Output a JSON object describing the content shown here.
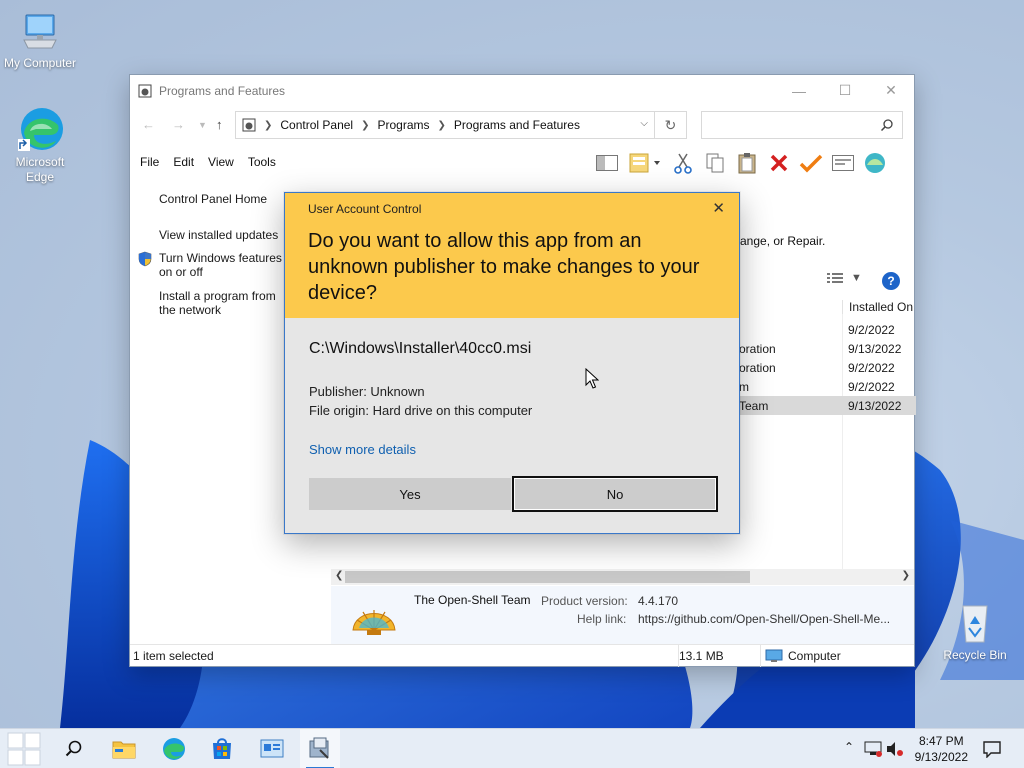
{
  "desktop": {
    "icons": [
      {
        "label": "My Computer"
      },
      {
        "label": "Microsoft Edge"
      },
      {
        "label": "Recycle Bin"
      }
    ]
  },
  "window": {
    "title": "Programs and Features",
    "breadcrumb": [
      "Control Panel",
      "Programs",
      "Programs and Features"
    ],
    "search_placeholder": "",
    "menu": [
      "File",
      "Edit",
      "View",
      "Tools"
    ],
    "left_links": {
      "home": "Control Panel Home",
      "updates": "View installed updates",
      "features": "Turn Windows features on or off",
      "install": "Install a program from the network"
    },
    "hint_text": "ange, or Repair.",
    "column_header": "Installed On",
    "rows": [
      {
        "publisher": "",
        "date": "9/2/2022",
        "selected": false
      },
      {
        "publisher": "oration",
        "date": "9/13/2022",
        "selected": false
      },
      {
        "publisher": "oration",
        "date": "9/2/2022",
        "selected": false
      },
      {
        "publisher": "m",
        "date": "9/2/2022",
        "selected": false
      },
      {
        "publisher": "Team",
        "date": "9/13/2022",
        "selected": true
      }
    ],
    "details": {
      "publisher": "The Open-Shell Team",
      "product_version_label": "Product version:",
      "product_version": "4.4.170",
      "help_link_label": "Help link:",
      "help_link": "https://github.com/Open-Shell/Open-Shell-Me..."
    },
    "status": {
      "selected": "1 item selected",
      "size": "13.1 MB",
      "location": "Computer"
    }
  },
  "uac": {
    "title": "User Account Control",
    "question": "Do you want to allow this app from an unknown publisher to make changes to your device?",
    "path": "C:\\Windows\\Installer\\40cc0.msi",
    "publisher": "Publisher: Unknown",
    "origin": "File origin: Hard drive on this computer",
    "more_details": "Show more details",
    "yes": "Yes",
    "no": "No",
    "header_color": "#fcc94c"
  },
  "taskbar": {
    "time": "8:47 PM",
    "date": "9/13/2022"
  }
}
